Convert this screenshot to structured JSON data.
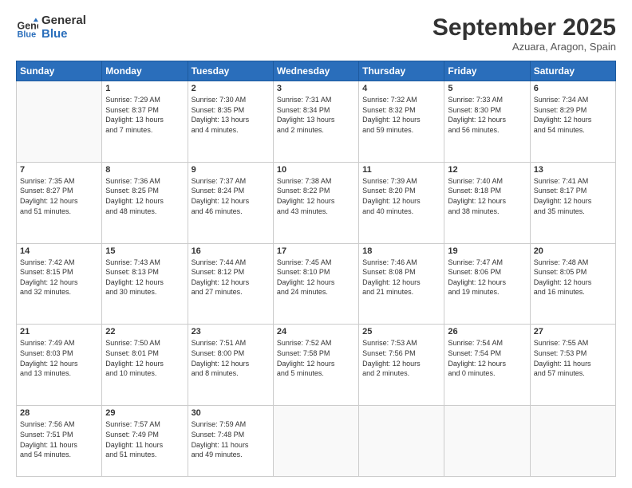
{
  "header": {
    "logo_line1": "General",
    "logo_line2": "Blue",
    "month_title": "September 2025",
    "location": "Azuara, Aragon, Spain"
  },
  "days_of_week": [
    "Sunday",
    "Monday",
    "Tuesday",
    "Wednesday",
    "Thursday",
    "Friday",
    "Saturday"
  ],
  "weeks": [
    [
      {
        "day": "",
        "info": ""
      },
      {
        "day": "1",
        "info": "Sunrise: 7:29 AM\nSunset: 8:37 PM\nDaylight: 13 hours\nand 7 minutes."
      },
      {
        "day": "2",
        "info": "Sunrise: 7:30 AM\nSunset: 8:35 PM\nDaylight: 13 hours\nand 4 minutes."
      },
      {
        "day": "3",
        "info": "Sunrise: 7:31 AM\nSunset: 8:34 PM\nDaylight: 13 hours\nand 2 minutes."
      },
      {
        "day": "4",
        "info": "Sunrise: 7:32 AM\nSunset: 8:32 PM\nDaylight: 12 hours\nand 59 minutes."
      },
      {
        "day": "5",
        "info": "Sunrise: 7:33 AM\nSunset: 8:30 PM\nDaylight: 12 hours\nand 56 minutes."
      },
      {
        "day": "6",
        "info": "Sunrise: 7:34 AM\nSunset: 8:29 PM\nDaylight: 12 hours\nand 54 minutes."
      }
    ],
    [
      {
        "day": "7",
        "info": "Sunrise: 7:35 AM\nSunset: 8:27 PM\nDaylight: 12 hours\nand 51 minutes."
      },
      {
        "day": "8",
        "info": "Sunrise: 7:36 AM\nSunset: 8:25 PM\nDaylight: 12 hours\nand 48 minutes."
      },
      {
        "day": "9",
        "info": "Sunrise: 7:37 AM\nSunset: 8:24 PM\nDaylight: 12 hours\nand 46 minutes."
      },
      {
        "day": "10",
        "info": "Sunrise: 7:38 AM\nSunset: 8:22 PM\nDaylight: 12 hours\nand 43 minutes."
      },
      {
        "day": "11",
        "info": "Sunrise: 7:39 AM\nSunset: 8:20 PM\nDaylight: 12 hours\nand 40 minutes."
      },
      {
        "day": "12",
        "info": "Sunrise: 7:40 AM\nSunset: 8:18 PM\nDaylight: 12 hours\nand 38 minutes."
      },
      {
        "day": "13",
        "info": "Sunrise: 7:41 AM\nSunset: 8:17 PM\nDaylight: 12 hours\nand 35 minutes."
      }
    ],
    [
      {
        "day": "14",
        "info": "Sunrise: 7:42 AM\nSunset: 8:15 PM\nDaylight: 12 hours\nand 32 minutes."
      },
      {
        "day": "15",
        "info": "Sunrise: 7:43 AM\nSunset: 8:13 PM\nDaylight: 12 hours\nand 30 minutes."
      },
      {
        "day": "16",
        "info": "Sunrise: 7:44 AM\nSunset: 8:12 PM\nDaylight: 12 hours\nand 27 minutes."
      },
      {
        "day": "17",
        "info": "Sunrise: 7:45 AM\nSunset: 8:10 PM\nDaylight: 12 hours\nand 24 minutes."
      },
      {
        "day": "18",
        "info": "Sunrise: 7:46 AM\nSunset: 8:08 PM\nDaylight: 12 hours\nand 21 minutes."
      },
      {
        "day": "19",
        "info": "Sunrise: 7:47 AM\nSunset: 8:06 PM\nDaylight: 12 hours\nand 19 minutes."
      },
      {
        "day": "20",
        "info": "Sunrise: 7:48 AM\nSunset: 8:05 PM\nDaylight: 12 hours\nand 16 minutes."
      }
    ],
    [
      {
        "day": "21",
        "info": "Sunrise: 7:49 AM\nSunset: 8:03 PM\nDaylight: 12 hours\nand 13 minutes."
      },
      {
        "day": "22",
        "info": "Sunrise: 7:50 AM\nSunset: 8:01 PM\nDaylight: 12 hours\nand 10 minutes."
      },
      {
        "day": "23",
        "info": "Sunrise: 7:51 AM\nSunset: 8:00 PM\nDaylight: 12 hours\nand 8 minutes."
      },
      {
        "day": "24",
        "info": "Sunrise: 7:52 AM\nSunset: 7:58 PM\nDaylight: 12 hours\nand 5 minutes."
      },
      {
        "day": "25",
        "info": "Sunrise: 7:53 AM\nSunset: 7:56 PM\nDaylight: 12 hours\nand 2 minutes."
      },
      {
        "day": "26",
        "info": "Sunrise: 7:54 AM\nSunset: 7:54 PM\nDaylight: 12 hours\nand 0 minutes."
      },
      {
        "day": "27",
        "info": "Sunrise: 7:55 AM\nSunset: 7:53 PM\nDaylight: 11 hours\nand 57 minutes."
      }
    ],
    [
      {
        "day": "28",
        "info": "Sunrise: 7:56 AM\nSunset: 7:51 PM\nDaylight: 11 hours\nand 54 minutes."
      },
      {
        "day": "29",
        "info": "Sunrise: 7:57 AM\nSunset: 7:49 PM\nDaylight: 11 hours\nand 51 minutes."
      },
      {
        "day": "30",
        "info": "Sunrise: 7:59 AM\nSunset: 7:48 PM\nDaylight: 11 hours\nand 49 minutes."
      },
      {
        "day": "",
        "info": ""
      },
      {
        "day": "",
        "info": ""
      },
      {
        "day": "",
        "info": ""
      },
      {
        "day": "",
        "info": ""
      }
    ]
  ]
}
